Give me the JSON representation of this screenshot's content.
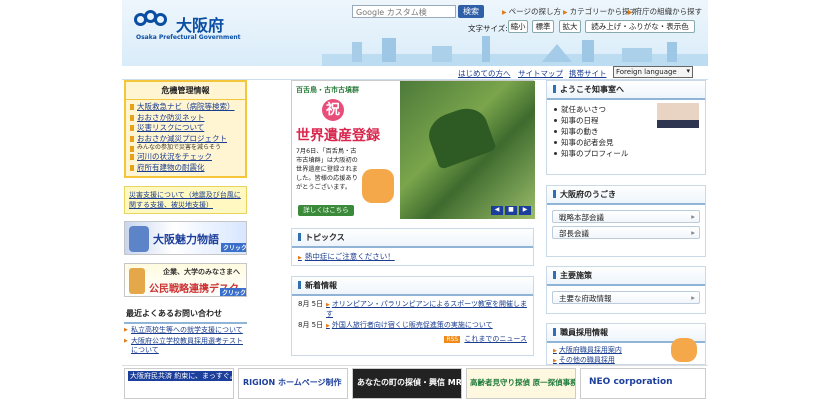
{
  "header": {
    "logo_jp": "大阪府",
    "logo_en": "Osaka Prefectural Government",
    "search_placeholder": "Google カスタム検",
    "search_button": "検索",
    "top_links": [
      "ページの探し方",
      "カテゴリーから探す",
      "府庁の組織から探す"
    ],
    "fontsize_label": "文字サイズ:",
    "size_buttons": [
      "縮小",
      "標準",
      "拡大"
    ],
    "reading_button": "読み上げ・ふりがな・表示色"
  },
  "nav": {
    "links": [
      "はじめての方へ",
      "サイトマップ",
      "携帯サイト"
    ],
    "language": "Foreign language"
  },
  "crisis": {
    "title": "危機管理情報",
    "items": [
      "大阪救急ナビ（病院等検索）",
      "おおさか防災ネット",
      "災害リスクについて",
      "おおさか減災プロジェクト",
      "みんなの参加で災害を減らそう",
      "河川の状況をチェック",
      "府所有建物の耐震化"
    ]
  },
  "disaster_link": "災害支援について（地震及び台風に関する支援、被災地支援）",
  "banner1": {
    "text": "大阪魅力物語",
    "sub": "クリック"
  },
  "banner2": {
    "top": "企業、大学のみなさまへ",
    "main": "公民戦略連携デスク",
    "sub": "クリック"
  },
  "faq": {
    "title": "最近よくあるお問い合わせ",
    "items": [
      "私立高校生等への就学支援について",
      "大阪府公立学校教員採用選考テストについて"
    ]
  },
  "feature": {
    "brand": "百舌鳥・古市古墳群",
    "celebrate": "祝",
    "headline": "世界遺産登録",
    "body": "7月6日、「百舌鳥・古市古墳群」は大阪初の世界遺産に登録されました。皆様の応援ありがとうございます。",
    "more": "詳しくはこちら"
  },
  "topics": {
    "title": "トピックス",
    "items": [
      "熱中症にご注意ください！"
    ]
  },
  "news": {
    "title": "新着情報",
    "items": [
      {
        "date": "8月 5日",
        "text": "オリンピアン・パラリンピアンによるスポーツ教室を開催します"
      },
      {
        "date": "8月 5日",
        "text": "外国人旅行者向け宿くじ販売促進策の実施について"
      }
    ],
    "rss": "RSS",
    "more": "これまでのニュース"
  },
  "governor": {
    "title": "ようこそ知事室へ",
    "items": [
      "就任あいさつ",
      "知事の日程",
      "知事の動き",
      "知事の記者会見",
      "知事のプロフィール"
    ]
  },
  "movement": {
    "title": "大阪府のうごき",
    "items": [
      "戦略本部会議",
      "部長会議"
    ]
  },
  "policy": {
    "title": "主要施策",
    "items": [
      "主要な府政情報"
    ]
  },
  "recruit": {
    "title": "職員採用情報",
    "items": [
      "大阪府職員採用案内",
      "その他の職員採用"
    ]
  },
  "ads": [
    "大阪府民共済 約束に、まっすぐ。地域相談会開催中！",
    "RIGION ホームページ制作",
    "あなたの町の探偵・興信 MR",
    "高齢者見守り探偵 原一探偵事務所",
    "NEO corporation"
  ],
  "colors": {
    "accent": "#0a4ea3",
    "link": "#1a3d8f",
    "crisis_border": "#f3c63c"
  }
}
